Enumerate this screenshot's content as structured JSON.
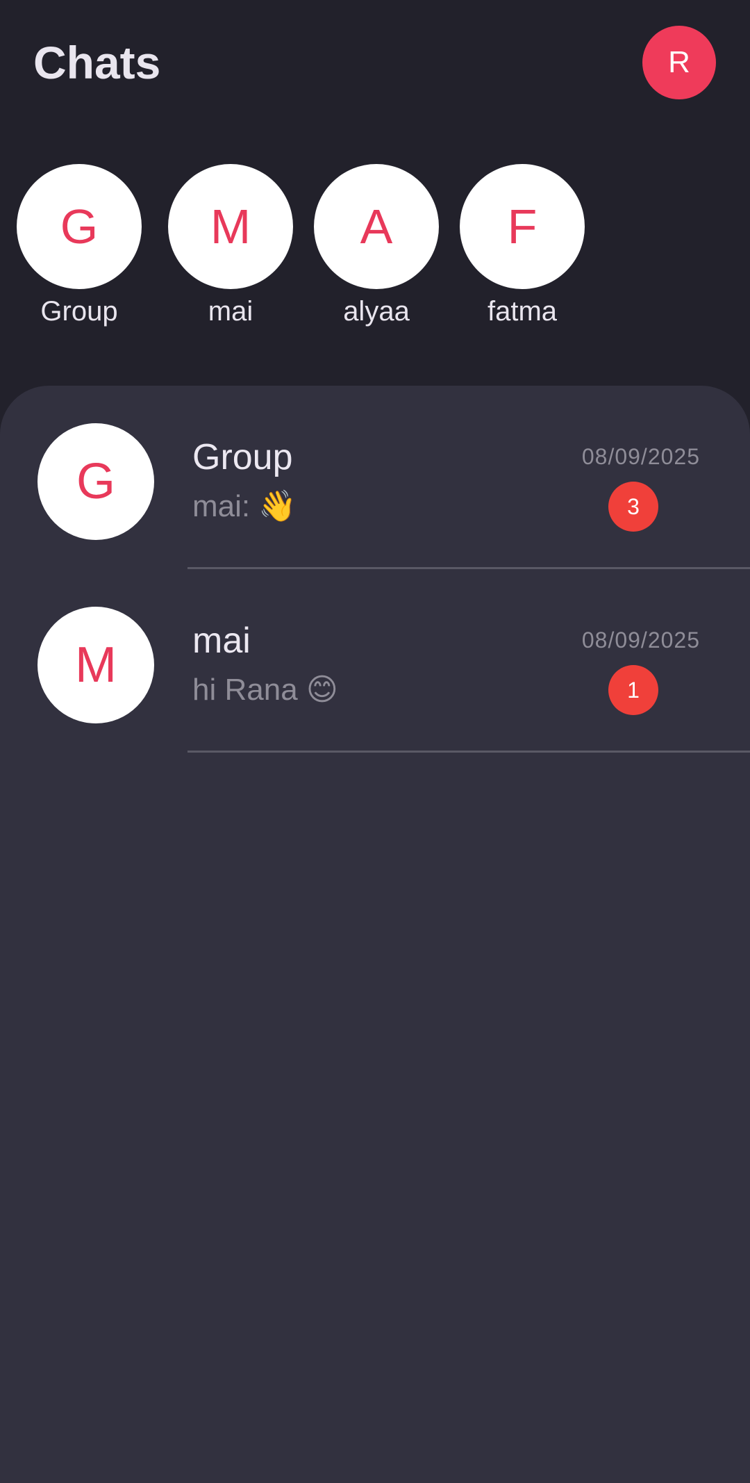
{
  "header": {
    "title": "Chats",
    "profile_initial": "R",
    "profile_color": "#ef3b5a"
  },
  "stories": [
    {
      "initial": "G",
      "label": "Group"
    },
    {
      "initial": "M",
      "label": "mai"
    },
    {
      "initial": "A",
      "label": "alyaa"
    },
    {
      "initial": "F",
      "label": "fatma"
    }
  ],
  "chats": [
    {
      "initial": "G",
      "name": "Group",
      "preview": "mai: 👋",
      "date": "08/09/2025",
      "unread": "3"
    },
    {
      "initial": "M",
      "name": "mai",
      "preview": "hi Rana 😊",
      "date": "08/09/2025",
      "unread": "1"
    }
  ],
  "colors": {
    "background": "#22212b",
    "panel": "#32313f",
    "accent": "#e8395a",
    "badge": "#f0403a"
  }
}
